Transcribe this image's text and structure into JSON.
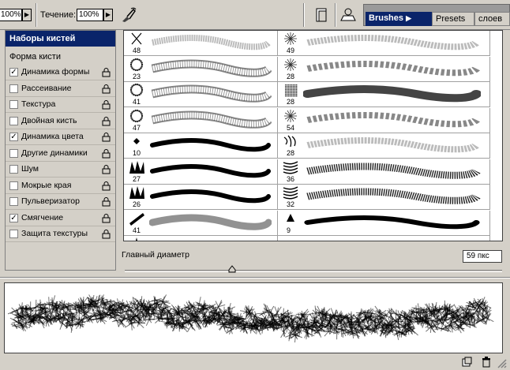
{
  "options_bar": {
    "opacity_value": "100%",
    "flow_label": "Течение:",
    "flow_value": "100%"
  },
  "tabs": {
    "brushes": "Brushes",
    "presets": "Presets",
    "layers": "слоев"
  },
  "side": {
    "header": "Наборы кистей",
    "shape": "Форма кисти",
    "items": [
      {
        "label": "Динамика формы",
        "checked": "✓"
      },
      {
        "label": "Рассеивание",
        "checked": ""
      },
      {
        "label": "Текстура",
        "checked": ""
      },
      {
        "label": "Двойная кисть",
        "checked": ""
      },
      {
        "label": "Динамика цвета",
        "checked": "✓"
      },
      {
        "label": "Другие динамики",
        "checked": ""
      },
      {
        "label": "Шум",
        "checked": ""
      },
      {
        "label": "Мокрые края",
        "checked": ""
      },
      {
        "label": "Пульверизатор",
        "checked": ""
      },
      {
        "label": "Смягчение",
        "checked": "✓"
      },
      {
        "label": "Защита текстуры",
        "checked": ""
      }
    ]
  },
  "brushes": {
    "left": [
      {
        "size": "48",
        "tip": "cross",
        "stroke": "light"
      },
      {
        "size": "23",
        "tip": "ring",
        "stroke": "ring"
      },
      {
        "size": "41",
        "tip": "ring",
        "stroke": "ring"
      },
      {
        "size": "47",
        "tip": "ring",
        "stroke": "ring"
      },
      {
        "size": "10",
        "tip": "diamond",
        "stroke": "solid"
      },
      {
        "size": "27",
        "tip": "zigzag",
        "stroke": "solid"
      },
      {
        "size": "26",
        "tip": "zigzag",
        "stroke": "solid"
      },
      {
        "size": "41",
        "tip": "streak",
        "stroke": "soft"
      },
      {
        "size": "",
        "tip": "star",
        "stroke": "none"
      }
    ],
    "right": [
      {
        "size": "49",
        "tip": "splat",
        "stroke": "light"
      },
      {
        "size": "28",
        "tip": "splat",
        "stroke": "star"
      },
      {
        "size": "28",
        "tip": "grain",
        "stroke": "dark"
      },
      {
        "size": "54",
        "tip": "splat",
        "stroke": "star"
      },
      {
        "size": "28",
        "tip": "spray",
        "stroke": "light"
      },
      {
        "size": "36",
        "tip": "grass",
        "stroke": "grass"
      },
      {
        "size": "32",
        "tip": "grass",
        "stroke": "grass"
      },
      {
        "size": "9",
        "tip": "triangle",
        "stroke": "solid"
      },
      {
        "size": "",
        "tip": "dot",
        "stroke": "none"
      }
    ]
  },
  "master_diameter": {
    "label": "Главный диаметр",
    "value": "59 пкс",
    "slider_fraction": 0.285
  }
}
